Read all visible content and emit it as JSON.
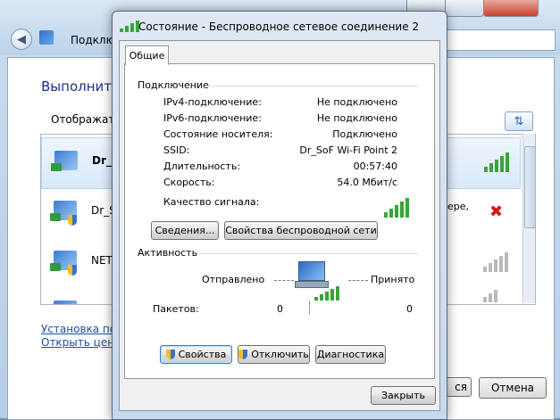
{
  "background": {
    "breadcrumb": "Подклю",
    "heading": "Выполнить",
    "show_label": "Отображать",
    "network_rows": [
      {
        "name": "Dr_S",
        "tail": "",
        "signal": "green"
      },
      {
        "name": "Dr_S",
        "tail": "ере,",
        "signal": "none"
      },
      {
        "name": "NET",
        "tail": "",
        "signal": "gray"
      },
      {
        "name": "",
        "tail": "",
        "signal": "gray"
      }
    ],
    "link_setup": "Установка под",
    "link_open": "Открыть центр",
    "connect_button_tail": "ся",
    "cancel_button": "Отмена",
    "refresh_icon": "refresh-icon",
    "error_icon": "red-x-icon"
  },
  "dialog": {
    "title": "Состояние - Беспроводное сетевое соединение 2",
    "tab_general": "Общие",
    "connection": {
      "group_title": "Подключение",
      "rows": [
        {
          "label": "IPv4-подключение:",
          "value": "Не подключено"
        },
        {
          "label": "IPv6-подключение:",
          "value": "Не подключено"
        },
        {
          "label": "Состояние носителя:",
          "value": "Подключено"
        },
        {
          "label": "SSID:",
          "value": "Dr_SoF Wi-Fi Point 2"
        },
        {
          "label": "Длительность:",
          "value": "00:57:40"
        },
        {
          "label": "Скорость:",
          "value": "54.0 Мбит/с"
        }
      ],
      "signal_label": "Качество сигнала:",
      "signal_bars_filled": 5,
      "signal_bars_total": 5,
      "details_button": "Сведения...",
      "wireless_props_button": "Свойства беспроводной сети"
    },
    "activity": {
      "group_title": "Активность",
      "sent_label": "Отправлено",
      "received_label": "Принято",
      "packets_label": "Пакетов:",
      "packets_sent": "0",
      "packets_received": "0"
    },
    "properties_button": "Свойства",
    "disable_button": "Отключить",
    "diagnose_button": "Диагностика",
    "close_button": "Закрыть",
    "signal_color": "#3aa33a"
  }
}
